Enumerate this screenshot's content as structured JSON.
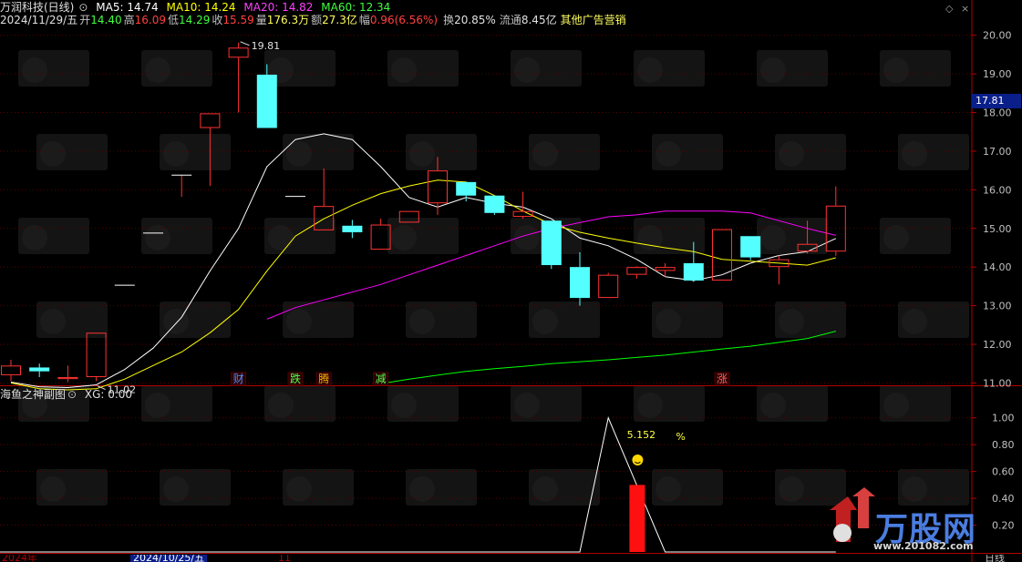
{
  "header": {
    "title": "万润科技(日线)",
    "ma5_label": "MA5: 14.74",
    "ma10_label": "MA10: 14.24",
    "ma20_label": "MA20: 14.82",
    "ma60_label": "MA60: 12.34",
    "date": "2024/11/29/五",
    "open_label": "开",
    "open": "14.40",
    "high_label": "高",
    "high": "16.09",
    "low_label": "低",
    "low": "14.29",
    "close_label": "收",
    "close": "15.59",
    "volume_label": "量",
    "volume": "176.3万",
    "amount_label": "额",
    "amount": "27.3亿",
    "change_label": "幅",
    "change": "0.96(6.56%)",
    "turnover_label": "换",
    "turnover": "20.85%",
    "float_label": "流通",
    "float": "8.45亿",
    "sector": "其他广告营销"
  },
  "sub_header": {
    "title": "海鱼之神副图",
    "xg": "XG: 0.00"
  },
  "price_panel": {
    "current_price": "17.81",
    "high_marker": "19.81",
    "low_marker": "11.02",
    "event_tags": [
      {
        "text": "财",
        "color": "#4f8fff",
        "bar": 8
      },
      {
        "text": "跌",
        "color": "#50ff50",
        "bar": 10
      },
      {
        "text": "腾",
        "color": "#ffb000",
        "bar": 11
      },
      {
        "text": "减",
        "color": "#50ff50",
        "bar": 13
      },
      {
        "text": "涨",
        "color": "#ff6060",
        "bar": 25
      }
    ]
  },
  "indicator_panel": {
    "percent_text": "5.152",
    "percent_sign": "%"
  },
  "axis_bottom": {
    "left_label": "2024年",
    "cursor_date": "2024/10/25/五",
    "tick": "11",
    "right_label": "日线"
  },
  "watermark": {
    "brand": "万股网",
    "url": "www.201082.com"
  },
  "colors": {
    "up": "#ff3232",
    "down": "#54ffff",
    "ma5": "#ffffff",
    "ma10": "#ffff00",
    "ma20": "#ff00ff",
    "ma60": "#00ff00",
    "axis": "#b00000"
  },
  "chart_data": [
    {
      "type": "candlestick",
      "title": "万润科技(日线)",
      "ylim": [
        10.75,
        20.3
      ],
      "y_ticks": [
        11.0,
        12.0,
        13.0,
        14.0,
        15.0,
        16.0,
        17.0,
        18.0,
        19.0,
        20.0
      ],
      "candles": [
        {
          "o": 11.2,
          "h": 11.6,
          "l": 11.05,
          "c": 11.45
        },
        {
          "o": 11.4,
          "h": 11.5,
          "l": 11.15,
          "c": 11.3
        },
        {
          "o": 11.1,
          "h": 11.45,
          "l": 11.02,
          "c": 11.15
        },
        {
          "o": 11.15,
          "h": 12.3,
          "l": 11.05,
          "c": 12.3
        },
        {
          "o": 13.53,
          "h": 13.53,
          "l": 13.53,
          "c": 13.53
        },
        {
          "o": 14.88,
          "h": 14.88,
          "l": 14.88,
          "c": 14.88
        },
        {
          "o": 16.38,
          "h": 16.38,
          "l": 15.82,
          "c": 16.38
        },
        {
          "o": 17.6,
          "h": 17.98,
          "l": 16.1,
          "c": 17.98
        },
        {
          "o": 19.42,
          "h": 19.81,
          "l": 18.0,
          "c": 19.68
        },
        {
          "o": 18.98,
          "h": 19.25,
          "l": 17.6,
          "c": 17.6
        },
        {
          "o": 15.83,
          "h": 15.83,
          "l": 15.83,
          "c": 15.83
        },
        {
          "o": 14.95,
          "h": 16.55,
          "l": 14.95,
          "c": 15.58
        },
        {
          "o": 15.07,
          "h": 15.22,
          "l": 14.75,
          "c": 14.9
        },
        {
          "o": 14.45,
          "h": 15.25,
          "l": 14.45,
          "c": 15.1
        },
        {
          "o": 15.15,
          "h": 15.45,
          "l": 15.15,
          "c": 15.45
        },
        {
          "o": 15.65,
          "h": 16.85,
          "l": 15.35,
          "c": 16.5
        },
        {
          "o": 16.2,
          "h": 16.2,
          "l": 15.7,
          "c": 15.85
        },
        {
          "o": 15.85,
          "h": 15.85,
          "l": 15.35,
          "c": 15.4
        },
        {
          "o": 15.3,
          "h": 15.95,
          "l": 15.25,
          "c": 15.45
        },
        {
          "o": 15.2,
          "h": 15.2,
          "l": 13.95,
          "c": 14.05
        },
        {
          "o": 14.0,
          "h": 14.38,
          "l": 13.0,
          "c": 13.2
        },
        {
          "o": 13.2,
          "h": 13.85,
          "l": 13.2,
          "c": 13.8
        },
        {
          "o": 13.8,
          "h": 14.02,
          "l": 13.7,
          "c": 14.0
        },
        {
          "o": 13.9,
          "h": 14.1,
          "l": 13.75,
          "c": 14.0
        },
        {
          "o": 14.1,
          "h": 14.65,
          "l": 13.62,
          "c": 13.65
        },
        {
          "o": 13.65,
          "h": 14.98,
          "l": 13.65,
          "c": 14.98
        },
        {
          "o": 14.8,
          "h": 14.8,
          "l": 14.18,
          "c": 14.25
        },
        {
          "o": 14.0,
          "h": 14.3,
          "l": 13.55,
          "c": 14.2
        },
        {
          "o": 14.4,
          "h": 15.2,
          "l": 14.35,
          "c": 14.6
        },
        {
          "o": 14.4,
          "h": 16.09,
          "l": 14.29,
          "c": 15.59
        }
      ],
      "series": [
        {
          "name": "MA5",
          "values": [
            11.02,
            10.9,
            10.88,
            10.95,
            11.35,
            11.9,
            12.7,
            13.9,
            15.0,
            16.6,
            17.3,
            17.45,
            17.3,
            16.6,
            15.8,
            15.55,
            15.8,
            15.65,
            15.55,
            15.25,
            14.75,
            14.55,
            14.2,
            13.75,
            13.65,
            13.8,
            14.1,
            14.3,
            14.4,
            14.74
          ]
        },
        {
          "name": "MA10",
          "values": [
            11.0,
            10.85,
            10.82,
            10.85,
            11.1,
            11.45,
            11.8,
            12.3,
            12.9,
            13.9,
            14.8,
            15.25,
            15.6,
            15.9,
            16.1,
            16.25,
            16.2,
            15.85,
            15.45,
            15.1,
            14.9,
            14.75,
            14.62,
            14.5,
            14.4,
            14.2,
            14.15,
            14.1,
            14.05,
            14.24
          ]
        },
        {
          "name": "MA20",
          "values": [
            null,
            null,
            null,
            null,
            null,
            null,
            null,
            null,
            null,
            12.65,
            12.95,
            13.15,
            13.35,
            13.55,
            13.8,
            14.05,
            14.3,
            14.55,
            14.8,
            15.0,
            15.15,
            15.3,
            15.35,
            15.45,
            15.45,
            15.45,
            15.4,
            15.2,
            15.0,
            14.82
          ]
        },
        {
          "name": "MA60",
          "values": [
            null,
            null,
            null,
            null,
            null,
            null,
            null,
            null,
            null,
            null,
            null,
            null,
            null,
            10.98,
            11.1,
            11.2,
            11.3,
            11.37,
            11.43,
            11.5,
            11.55,
            11.6,
            11.66,
            11.72,
            11.8,
            11.88,
            11.95,
            12.05,
            12.15,
            12.34
          ]
        }
      ]
    },
    {
      "type": "line",
      "title": "海鱼之神副图",
      "ylim": [
        0,
        1.1
      ],
      "y_ticks": [
        0.2,
        0.4,
        0.6,
        0.8,
        1.0
      ],
      "series": [
        {
          "name": "XG",
          "values": [
            0,
            0,
            0,
            0,
            0,
            0,
            0,
            0,
            0,
            0,
            0,
            0,
            0,
            0,
            0,
            0,
            0,
            0,
            0,
            0,
            0,
            1.0,
            0.5,
            0,
            0,
            0,
            0,
            0,
            0,
            0
          ]
        }
      ],
      "bar": {
        "index": 22,
        "value": 0.5
      }
    }
  ]
}
